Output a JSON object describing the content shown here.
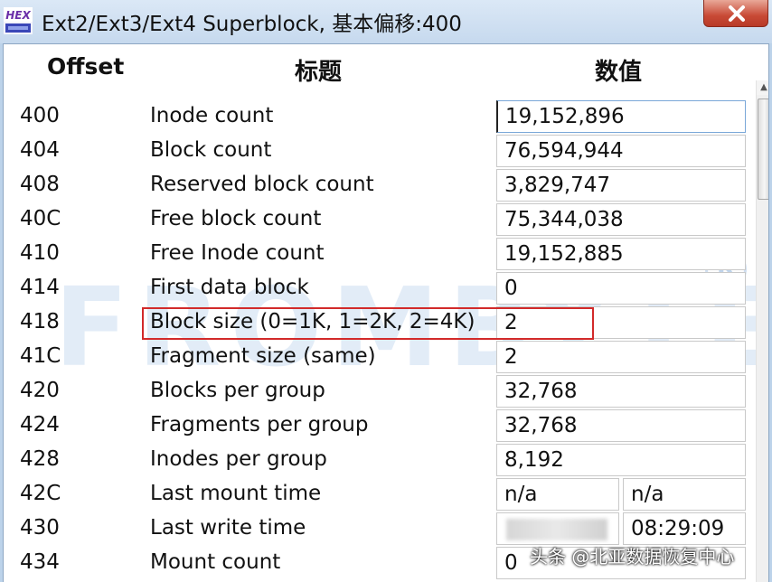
{
  "window": {
    "title": "Ext2/Ext3/Ext4 Superblock, 基本偏移:400",
    "logo_text": "HEX"
  },
  "columns": {
    "offset": "Offset",
    "title": "标题",
    "value": "数值"
  },
  "rows": [
    {
      "offset": "400",
      "title": "Inode count",
      "value": "19,152,896"
    },
    {
      "offset": "404",
      "title": "Block count",
      "value": "76,594,944"
    },
    {
      "offset": "408",
      "title": "Reserved block count",
      "value": "3,829,747"
    },
    {
      "offset": "40C",
      "title": "Free block count",
      "value": "75,344,038"
    },
    {
      "offset": "410",
      "title": "Free Inode count",
      "value": "19,152,885"
    },
    {
      "offset": "414",
      "title": "First data block",
      "value": "0"
    },
    {
      "offset": "418",
      "title": "Block size (0=1K, 1=2K, 2=4K)",
      "value": "2"
    },
    {
      "offset": "41C",
      "title": "Fragment size (same)",
      "value": "2"
    },
    {
      "offset": "420",
      "title": "Blocks per group",
      "value": "32,768"
    },
    {
      "offset": "424",
      "title": "Fragments per group",
      "value": "32,768"
    },
    {
      "offset": "428",
      "title": "Inodes per group",
      "value": "8,192"
    },
    {
      "offset": "42C",
      "title": "Last mount time",
      "value_a": "n/a",
      "value_b": "n/a"
    },
    {
      "offset": "430",
      "title": "Last write time",
      "value_b": "08:29:09"
    },
    {
      "offset": "434",
      "title": "Mount count",
      "value": "0"
    }
  ],
  "watermark": {
    "text": "FROMBYTE",
    "registered": "R",
    "source": "头条 @北亚数据恢复中心"
  },
  "colors": {
    "highlight": "#d22a2a",
    "titlebar": "#c6d9ee"
  }
}
